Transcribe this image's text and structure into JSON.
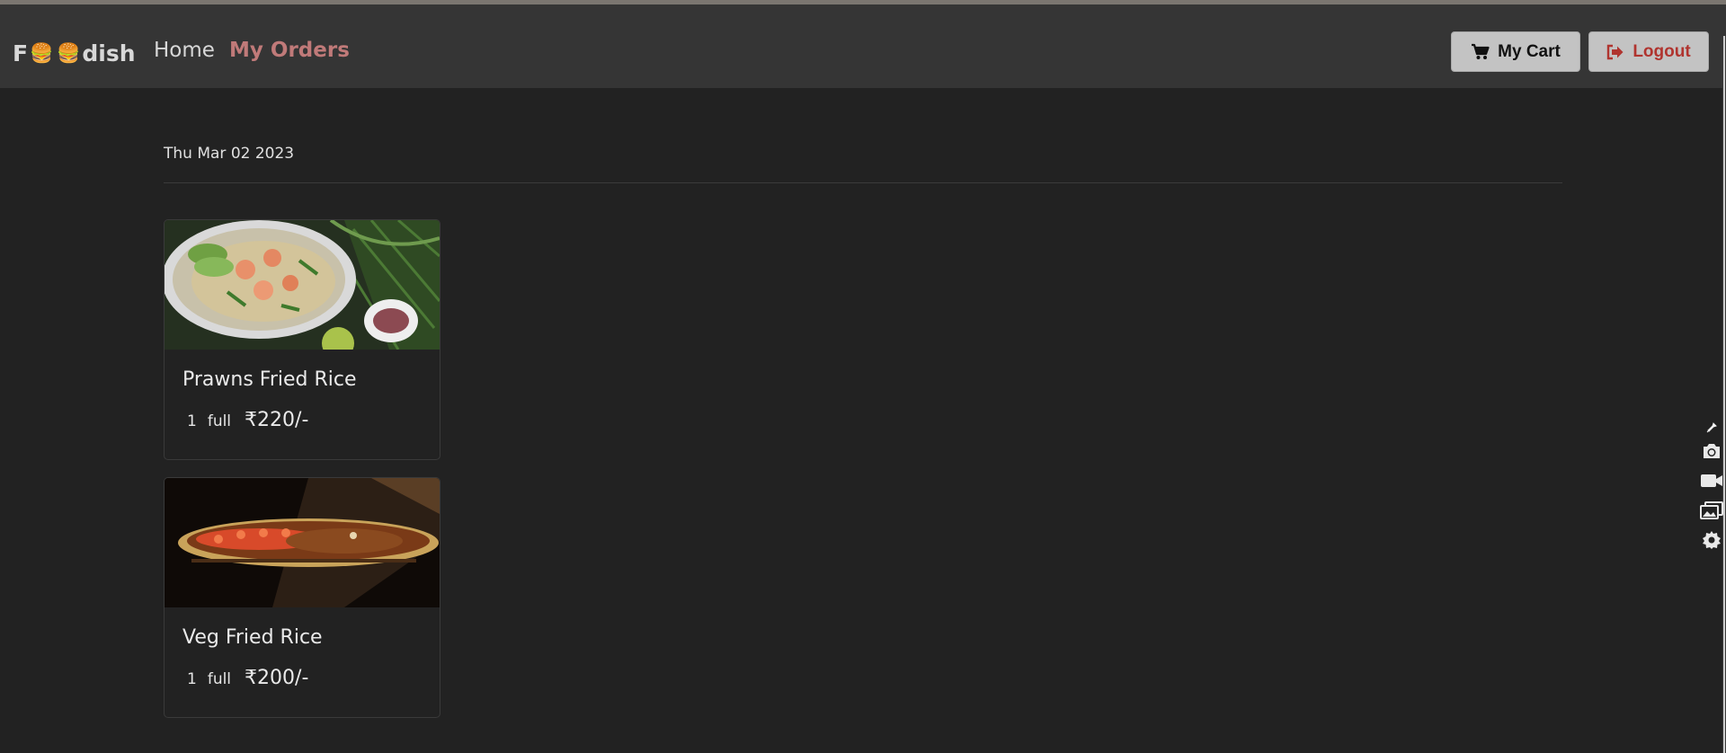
{
  "app": {
    "brand_prefix": "F",
    "brand_icon_1": "🍔",
    "brand_icon_2": "🍔",
    "brand_suffix": "dish"
  },
  "nav": {
    "home": "Home",
    "orders": "My Orders"
  },
  "actions": {
    "cart": "My Cart",
    "logout": "Logout"
  },
  "orders": [
    {
      "date": "Thu Mar 02 2023",
      "items": [
        {
          "name": "Prawns Fried Rice",
          "qty": "1",
          "size": "full",
          "price": "₹220/-"
        },
        {
          "name": "Veg Fried Rice",
          "qty": "1",
          "size": "full",
          "price": "₹200/-"
        }
      ]
    }
  ],
  "side_tools": [
    "pin-icon",
    "camera-icon",
    "video-icon",
    "gallery-icon",
    "gear-icon"
  ],
  "colors": {
    "background": "#222222",
    "navbar": "#353535",
    "active_nav": "#c07a79",
    "logout_text": "#b0342f",
    "button_bg": "#c3c3c3"
  }
}
